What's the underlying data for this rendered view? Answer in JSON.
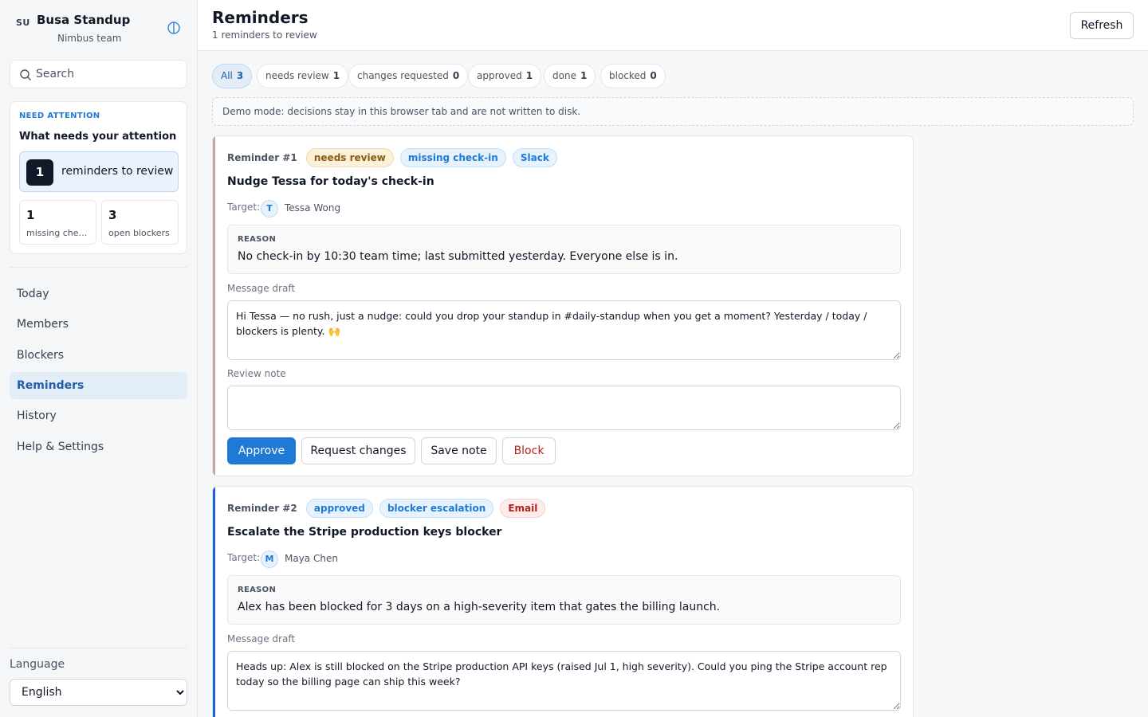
{
  "brand": {
    "logo_text": "SU",
    "title": "Busa Standup",
    "team": "Nimbus team"
  },
  "search": {
    "placeholder": "Search"
  },
  "attention": {
    "kicker": "NEED ATTENTION",
    "title": "What needs your attention",
    "main": {
      "count": "1",
      "label": "reminders to review"
    },
    "mini": [
      {
        "count": "1",
        "label": "missing check-ins"
      },
      {
        "count": "3",
        "label": "open blockers"
      }
    ]
  },
  "nav": {
    "items": [
      {
        "label": "Today"
      },
      {
        "label": "Members"
      },
      {
        "label": "Blockers"
      },
      {
        "label": "Reminders",
        "active": true
      },
      {
        "label": "History"
      },
      {
        "label": "Help & Settings"
      }
    ]
  },
  "language": {
    "label": "Language",
    "selected": "English"
  },
  "header": {
    "title": "Reminders",
    "subtitle": "1 reminders to review",
    "refresh_label": "Refresh"
  },
  "filters": [
    {
      "label": "All",
      "count": "3",
      "active": true
    },
    {
      "label": "needs review",
      "count": "1"
    },
    {
      "label": "changes requested",
      "count": "0"
    },
    {
      "label": "approved",
      "count": "1"
    },
    {
      "label": "done",
      "count": "1"
    },
    {
      "label": "blocked",
      "count": "0"
    }
  ],
  "demo_banner": "Demo mode: decisions stay in this browser tab and are not written to disk.",
  "colors": {
    "accent": "#1f7ad6",
    "needs_review_stripe": "#c9a39c",
    "approved_stripe": "#1f5fd6",
    "danger": "#b42318"
  },
  "reminders": [
    {
      "id_label": "Reminder #1",
      "status": "needs review",
      "type": "missing check-in",
      "channel": "Slack",
      "title": "Nudge Tessa for today's check-in",
      "target_label": "Target:",
      "target_initial": "T",
      "target_name": "Tessa Wong",
      "reason_kicker": "REASON",
      "reason": "No check-in by 10:30 team time; last submitted yesterday. Everyone else is in.",
      "draft_label": "Message draft",
      "draft": "Hi Tessa — no rush, just a nudge: could you drop your standup in #daily-standup when you get a moment? Yesterday / today / blockers is plenty. 🙌",
      "note_label": "Review note",
      "note": "",
      "actions": {
        "approve": "Approve",
        "request_changes": "Request changes",
        "save_note": "Save note",
        "block": "Block"
      }
    },
    {
      "id_label": "Reminder #2",
      "status": "approved",
      "type": "blocker escalation",
      "channel": "Email",
      "title": "Escalate the Stripe production keys blocker",
      "target_label": "Target:",
      "target_initial": "M",
      "target_name": "Maya Chen",
      "reason_kicker": "REASON",
      "reason": "Alex has been blocked for 3 days on a high-severity item that gates the billing launch.",
      "draft_label": "Message draft",
      "draft": "Heads up: Alex is still blocked on the Stripe production API keys (raised Jul 1, high severity). Could you ping the Stripe account rep today so the billing page can ship this week?"
    }
  ]
}
